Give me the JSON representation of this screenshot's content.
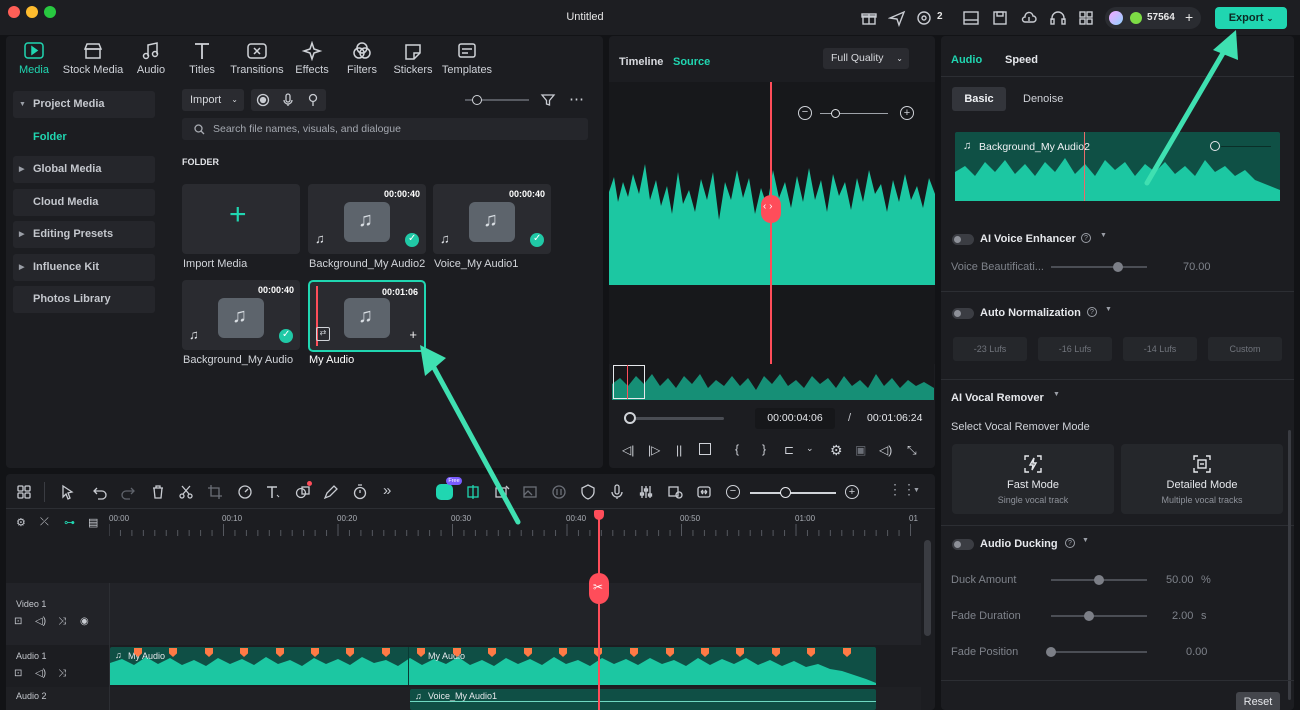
{
  "window": {
    "title": "Untitled",
    "credits": "57564",
    "notifications": "2",
    "export_label": "Export"
  },
  "colors": {
    "accent": "#20d6b1",
    "playhead": "#ff4d5a",
    "marker": "#ff7a45"
  },
  "media_tabs": [
    "Media",
    "Stock Media",
    "Audio",
    "Titles",
    "Transitions",
    "Effects",
    "Filters",
    "Stickers",
    "Templates"
  ],
  "sidebar": {
    "items": [
      "Project Media",
      "Folder",
      "Global Media",
      "Cloud Media",
      "Editing Presets",
      "Influence Kit",
      "Photos Library"
    ]
  },
  "media": {
    "import_label": "Import",
    "search_placeholder": "Search file names, visuals, and dialogue",
    "folder_heading": "FOLDER",
    "import_media_label": "Import Media",
    "items": [
      {
        "name": "Background_My Audio2",
        "duration": "00:00:40"
      },
      {
        "name": "Voice_My Audio1",
        "duration": "00:00:40"
      },
      {
        "name": "Background_My Audio",
        "duration": "00:00:40"
      },
      {
        "name": "My Audio",
        "duration": "00:01:06"
      }
    ]
  },
  "preview": {
    "tab_timeline": "Timeline",
    "tab_source": "Source",
    "quality": "Full Quality",
    "current_time": "00:00:04:06",
    "separator": "/",
    "total_time": "00:01:06:24",
    "progress": 0.06
  },
  "right_panel": {
    "tabs": [
      "Audio",
      "Speed"
    ],
    "subtabs": [
      "Basic",
      "Denoise"
    ],
    "clip_name": "Background_My Audio2",
    "ai_voice_enhancer": {
      "label": "AI Voice Enhancer",
      "param": "Voice Beautificati...",
      "value": "70.00",
      "level": 0.7
    },
    "auto_normalization": {
      "label": "Auto Normalization",
      "presets": [
        "-23 Lufs",
        "-16 Lufs",
        "-14 Lufs",
        "Custom"
      ]
    },
    "vocal_remover": {
      "label": "AI Vocal Remover",
      "select_label": "Select Vocal Remover Mode",
      "fast": {
        "title": "Fast Mode",
        "desc": "Single vocal track"
      },
      "detailed": {
        "title": "Detailed Mode",
        "desc": "Multiple vocal tracks"
      }
    },
    "audio_ducking": {
      "label": "Audio Ducking",
      "duck_amount": {
        "label": "Duck Amount",
        "value": "50.00",
        "unit": "%",
        "level": 0.5
      },
      "fade_duration": {
        "label": "Fade Duration",
        "value": "2.00",
        "unit": "s",
        "level": 0.4
      },
      "fade_position": {
        "label": "Fade Position",
        "value": "0.00",
        "level": 0.0
      }
    },
    "reset_label": "Reset"
  },
  "timeline": {
    "ticks": [
      "00:00",
      "00:10",
      "00:20",
      "00:30",
      "00:40",
      "00:50",
      "01:00",
      "01"
    ],
    "tracks": [
      "Video 1",
      "Audio 1",
      "Audio 2"
    ],
    "clip_audio1": "My Audio",
    "clip_audio1b": "My Audio",
    "clip_audio2": "Voice_My Audio1",
    "badge": "Free"
  }
}
